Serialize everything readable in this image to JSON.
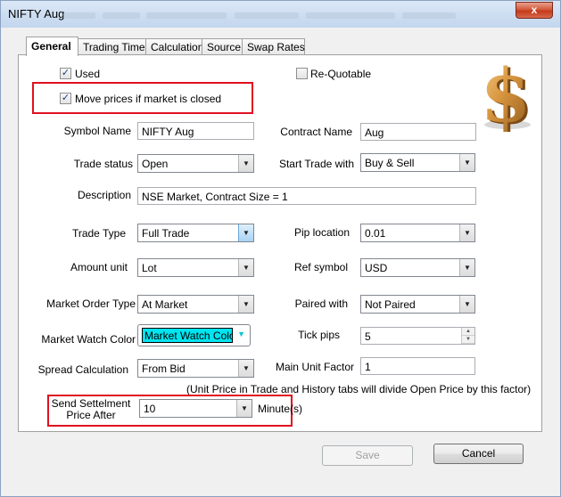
{
  "window": {
    "title": "NIFTY Aug",
    "close_glyph": "x"
  },
  "tabs": [
    "General",
    "Trading Times",
    "Calculation",
    "Source",
    "Swap Rates"
  ],
  "general": {
    "used": {
      "label": "Used",
      "checked": true
    },
    "re_quotable": {
      "label": "Re-Quotable",
      "checked": false
    },
    "move_prices": {
      "label": "Move prices if market is closed",
      "checked": true
    },
    "symbol_name": {
      "label": "Symbol Name",
      "value": "NIFTY Aug"
    },
    "contract_name": {
      "label": "Contract Name",
      "value": "Aug"
    },
    "trade_status": {
      "label": "Trade status",
      "value": "Open"
    },
    "start_trade_with": {
      "label": "Start Trade with",
      "value": "Buy & Sell"
    },
    "description": {
      "label": "Description",
      "value": "NSE Market, Contract Size = 1"
    },
    "trade_type": {
      "label": "Trade Type",
      "value": "Full Trade"
    },
    "pip_location": {
      "label": "Pip location",
      "value": "0.01"
    },
    "amount_unit": {
      "label": "Amount unit",
      "value": "Lot"
    },
    "ref_symbol": {
      "label": "Ref symbol",
      "value": "USD"
    },
    "market_order_type": {
      "label": "Market Order Type",
      "value": "At Market"
    },
    "paired_with": {
      "label": "Paired with",
      "value": "Not Paired"
    },
    "market_watch_color": {
      "label": "Market Watch Color",
      "value": "Market Watch Color",
      "swatch": "#00e5f0"
    },
    "tick_pips": {
      "label": "Tick pips",
      "value": "5"
    },
    "spread_calculation": {
      "label": "Spread Calculation",
      "value": "From Bid"
    },
    "main_unit_factor": {
      "label": "Main Unit Factor",
      "value": "1"
    },
    "unit_note": "(Unit Price in Trade and History tabs will divide Open Price by this factor)",
    "send_settlement": {
      "label_line1": "Send Settelment",
      "label_line2": "Price After",
      "value": "10",
      "unit": "Minute(s)"
    }
  },
  "buttons": {
    "save": "Save",
    "cancel": "Cancel"
  },
  "colors": {
    "highlight_box": "#e01020",
    "title_bar": "#cfdff2",
    "color_swatch": "#00e5f0"
  },
  "icons": [
    "dollar-sign-icon",
    "close-icon",
    "dropdown-arrow-icon",
    "checkmark-icon"
  ]
}
